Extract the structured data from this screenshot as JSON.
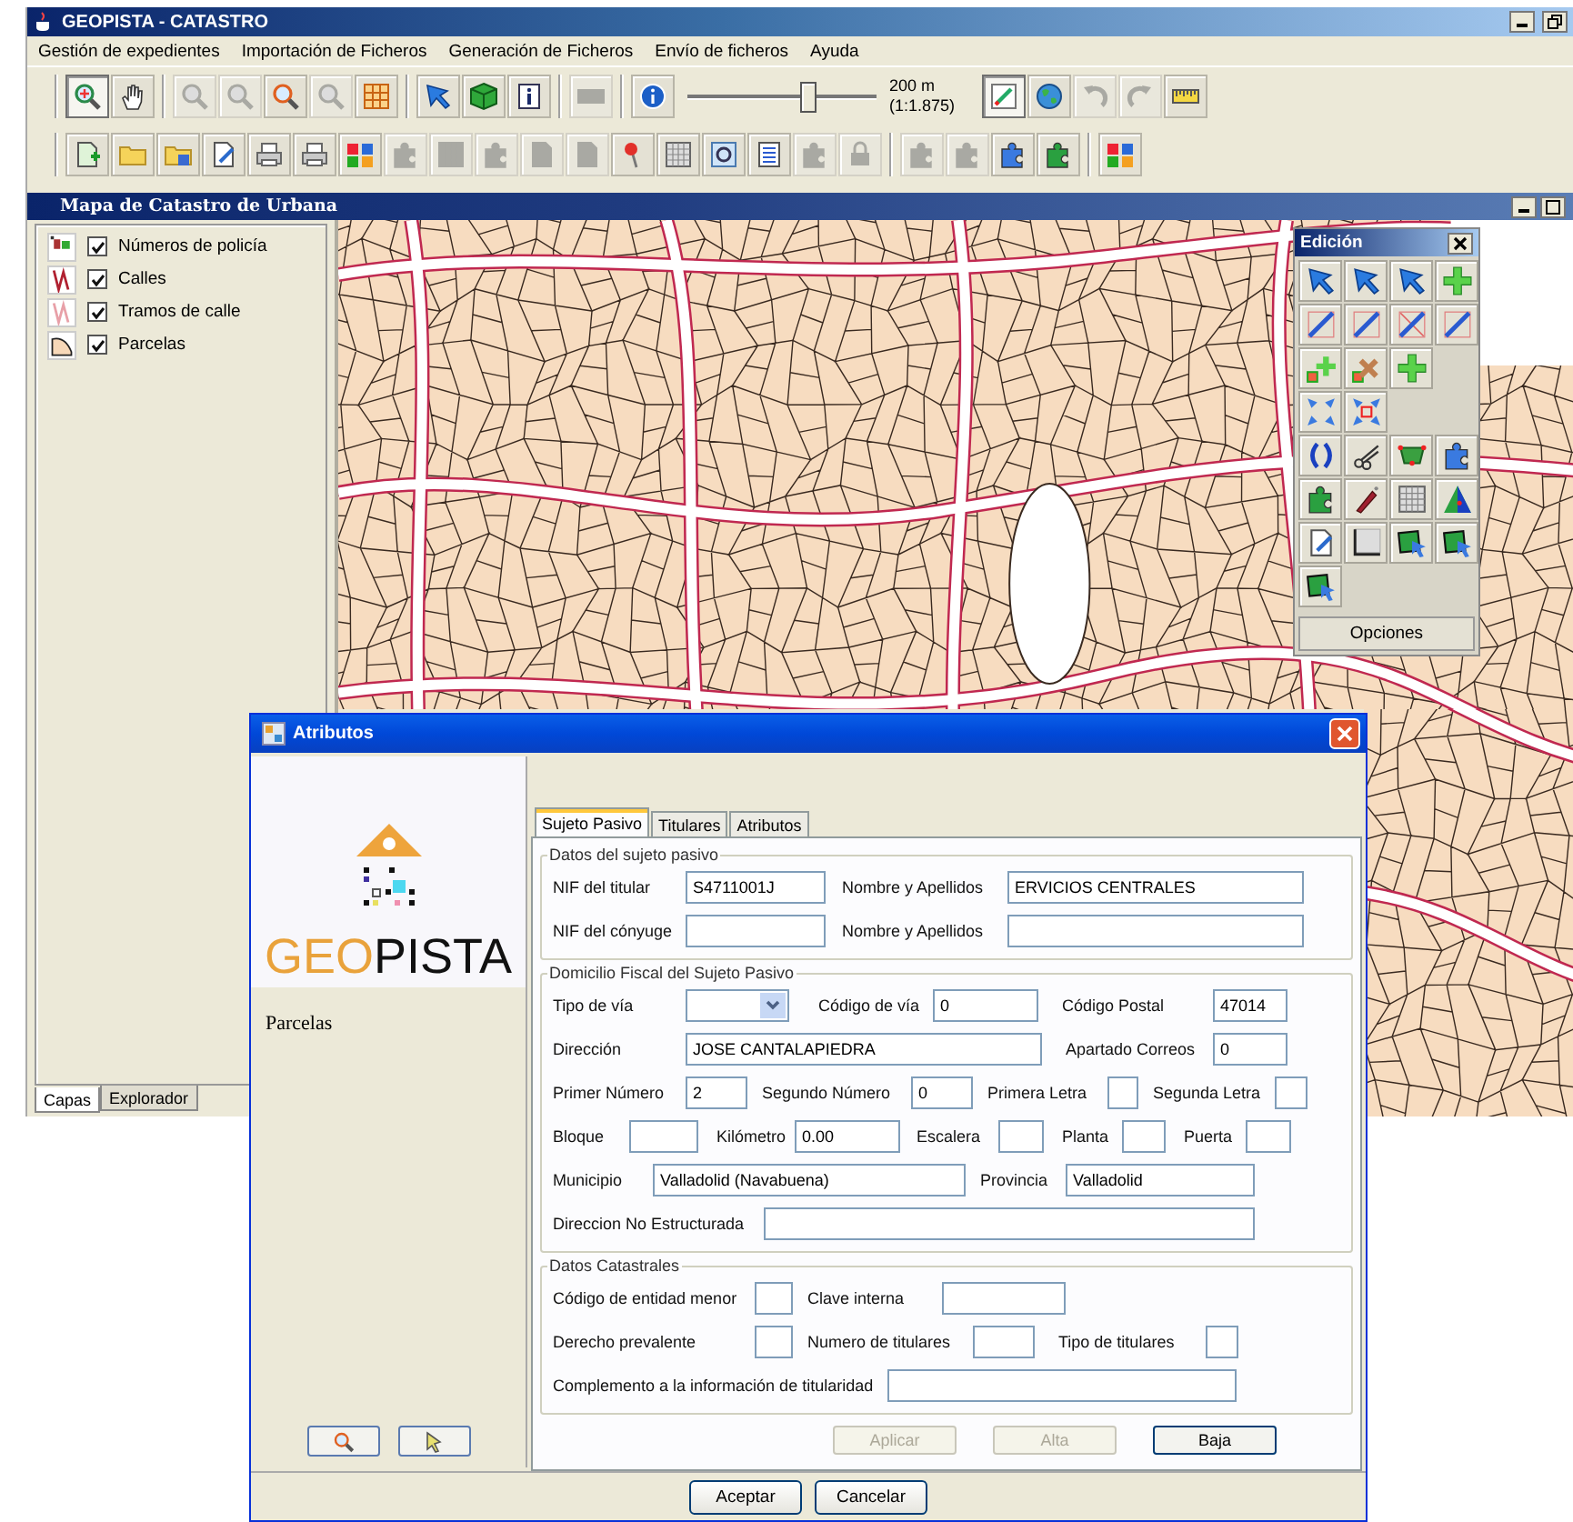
{
  "window": {
    "title": "GEOPISTA - CATASTRO"
  },
  "menu": [
    "Gestión de expedientes",
    "Importación de Ficheros",
    "Generación de Ficheros",
    "Envío de ficheros",
    "Ayuda"
  ],
  "toolbar_1": [
    {
      "selected": true,
      "disabled": false
    },
    {
      "selected": false,
      "disabled": false
    },
    {
      "selected": false,
      "disabled": true
    },
    {
      "selected": false,
      "disabled": true
    },
    {
      "selected": false,
      "disabled": false
    },
    {
      "selected": false,
      "disabled": true
    },
    {
      "selected": false,
      "disabled": false
    },
    {
      "selected": false,
      "disabled": false
    },
    {
      "selected": false,
      "disabled": false
    },
    {
      "selected": false,
      "disabled": false
    },
    {
      "selected": false,
      "disabled": true
    },
    {
      "selected": false,
      "disabled": false
    },
    {
      "selected": true,
      "disabled": false
    },
    {
      "selected": false,
      "disabled": false
    },
    {
      "selected": false,
      "disabled": true
    },
    {
      "selected": false,
      "disabled": true
    },
    {
      "selected": false,
      "disabled": false
    }
  ],
  "scale": {
    "level": 0.65,
    "distance": "200 m",
    "ratio": "(1:1.875)"
  },
  "toolbar_2": [
    {
      "disabled": false
    },
    {
      "disabled": false
    },
    {
      "disabled": false
    },
    {
      "disabled": false
    },
    {
      "disabled": false
    },
    {
      "disabled": false
    },
    {
      "disabled": false
    },
    {
      "disabled": true
    },
    {
      "disabled": true
    },
    {
      "disabled": true
    },
    {
      "disabled": true
    },
    {
      "disabled": true
    },
    {
      "disabled": false
    },
    {
      "disabled": false
    },
    {
      "disabled": false
    },
    {
      "disabled": false
    },
    {
      "disabled": true
    },
    {
      "disabled": true
    },
    {
      "disabled": true
    },
    {
      "disabled": true
    },
    {
      "disabled": false
    },
    {
      "disabled": false
    },
    {
      "disabled": false
    }
  ],
  "map_window": {
    "title": "Mapa de Catastro de Urbana"
  },
  "layers": [
    {
      "name": "Números de policía",
      "checked": true
    },
    {
      "name": "Calles",
      "checked": true
    },
    {
      "name": "Tramos de calle",
      "checked": true
    },
    {
      "name": "Parcelas",
      "checked": true
    }
  ],
  "panel_tabs": [
    {
      "label": "Capas",
      "selected": true
    },
    {
      "label": "Explorador",
      "selected": false
    }
  ],
  "edit_palette": {
    "title": "Edición",
    "options_button": "Opciones"
  },
  "dialog": {
    "title": "Atributos",
    "logo": {
      "lead": "GEO",
      "rest": "PISTA"
    },
    "layer": "Parcelas",
    "tabs": [
      {
        "label": "Sujeto Pasivo",
        "selected": true
      },
      {
        "label": "Titulares",
        "selected": false
      },
      {
        "label": "Atributos",
        "selected": false
      }
    ],
    "sections": [
      {
        "legend": "Datos del sujeto pasivo",
        "fields": [
          {
            "kind": "text",
            "label": "NIF del titular",
            "value": "S4711001J"
          },
          {
            "kind": "text",
            "label": "Nombre y Apellidos",
            "value": "ERVICIOS CENTRALES"
          },
          {
            "kind": "text",
            "label": "NIF del cónyuge"
          },
          {
            "kind": "text",
            "label": "Nombre y Apellidos"
          }
        ]
      },
      {
        "legend": "Domicilio Fiscal del Sujeto Pasivo",
        "fields": [
          {
            "kind": "combo",
            "label": "Tipo de vía"
          },
          {
            "kind": "text",
            "label": "Código de vía",
            "value": "0"
          },
          {
            "kind": "text",
            "label": "Código Postal",
            "value": "47014"
          },
          {
            "kind": "text",
            "label": "Dirección",
            "value": "JOSE CANTALAPIEDRA"
          },
          {
            "kind": "text",
            "label": "Apartado Correos",
            "value": "0"
          },
          {
            "kind": "text",
            "label": "Primer Número",
            "value": "2"
          },
          {
            "kind": "text",
            "label": "Segundo Número",
            "value": "0"
          },
          {
            "kind": "text",
            "label": "Primera Letra"
          },
          {
            "kind": "text",
            "label": "Segunda Letra"
          },
          {
            "kind": "text",
            "label": "Bloque"
          },
          {
            "kind": "text",
            "label": "Kilómetro",
            "value": "0.00"
          },
          {
            "kind": "text",
            "label": "Escalera"
          },
          {
            "kind": "text",
            "label": "Planta"
          },
          {
            "kind": "text",
            "label": "Puerta"
          },
          {
            "kind": "text",
            "label": "Municipio",
            "value": "Valladolid (Navabuena)"
          },
          {
            "kind": "text",
            "label": "Provincia",
            "value": "Valladolid"
          },
          {
            "kind": "text",
            "label": "Direccion No Estructurada"
          }
        ]
      },
      {
        "legend": "Datos Catastrales",
        "fields": [
          {
            "kind": "text",
            "label": "Código de entidad menor"
          },
          {
            "kind": "text",
            "label": "Clave interna"
          },
          {
            "kind": "text",
            "label": "Derecho prevalente"
          },
          {
            "kind": "text",
            "label": "Numero de titulares"
          },
          {
            "kind": "text",
            "label": "Tipo de titulares"
          },
          {
            "kind": "text",
            "label": "Complemento a la información de titularidad"
          }
        ]
      }
    ],
    "actions": [
      {
        "label": "Aplicar",
        "disabled": true
      },
      {
        "label": "Alta",
        "disabled": true
      },
      {
        "label": "Baja",
        "disabled": false
      }
    ],
    "buttons": [
      "Aceptar",
      "Cancelar"
    ]
  }
}
